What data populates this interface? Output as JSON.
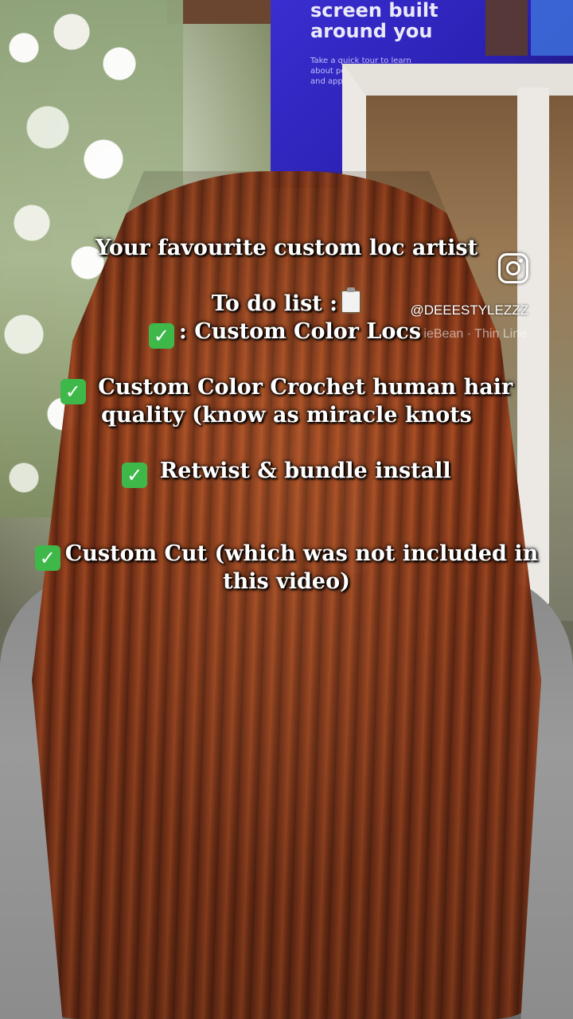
{
  "tv": {
    "headline": "screen built around you",
    "subtext": "Take a quick tour to learn about personalized features and apps. Press"
  },
  "caption": {
    "title": "Your favourite custom loc artist",
    "todo_header": "To do list :",
    "item1": ": Custom Color Locs",
    "item2_line1": "Custom Color Crochet human hair",
    "item2_line2": "quality (know as miracle knots",
    "item3": "Retwist & bundle install",
    "item4_line1": "Custom Cut (which was not included in",
    "item4_line2": "this video)"
  },
  "watermark": {
    "icon": "instagram-icon",
    "handle": "@DEEESTYLEZZZ",
    "font_credit": "ieBean · Thin Line"
  },
  "colors": {
    "check_green": "#3fb84a",
    "text": "#ffffff",
    "hair": "#8e3a1a"
  }
}
